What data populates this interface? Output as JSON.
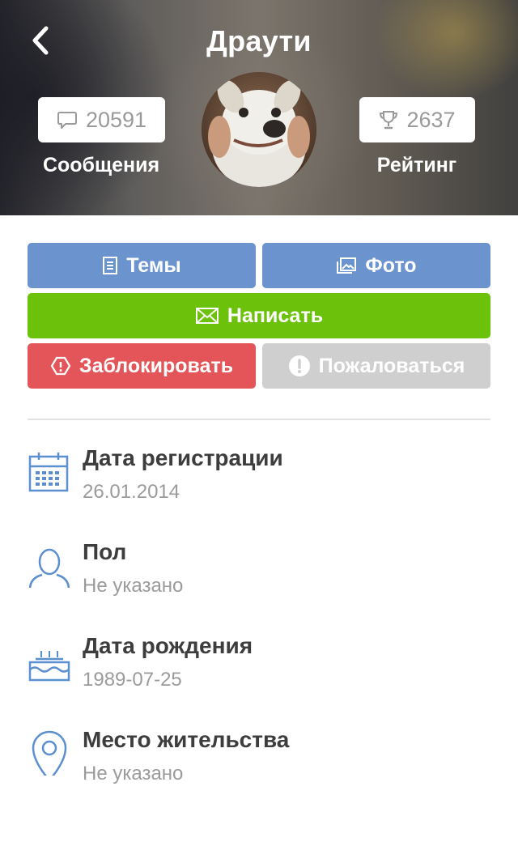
{
  "header": {
    "title": "Драути",
    "messages": {
      "count": "20591",
      "label": "Сообщения"
    },
    "rating": {
      "count": "2637",
      "label": "Рейтинг"
    }
  },
  "actions": {
    "topics_label": "Темы",
    "photo_label": "Фото",
    "write_label": "Написать",
    "block_label": "Заблокировать",
    "report_label": "Пожаловаться"
  },
  "info": [
    {
      "title": "Дата регистрации",
      "value": "26.01.2014",
      "icon": "calendar-icon"
    },
    {
      "title": "Пол",
      "value": "Не указано",
      "icon": "user-icon"
    },
    {
      "title": "Дата рождения",
      "value": "1989-07-25",
      "icon": "birthday-cake-icon"
    },
    {
      "title": "Место жительства",
      "value": "Не указано",
      "icon": "location-pin-icon"
    }
  ],
  "colors": {
    "blue": "#6b94cf",
    "green": "#6cc20a",
    "red": "#e45559",
    "grey": "#cfcfcf",
    "icon_blue": "#5b8fd0"
  }
}
